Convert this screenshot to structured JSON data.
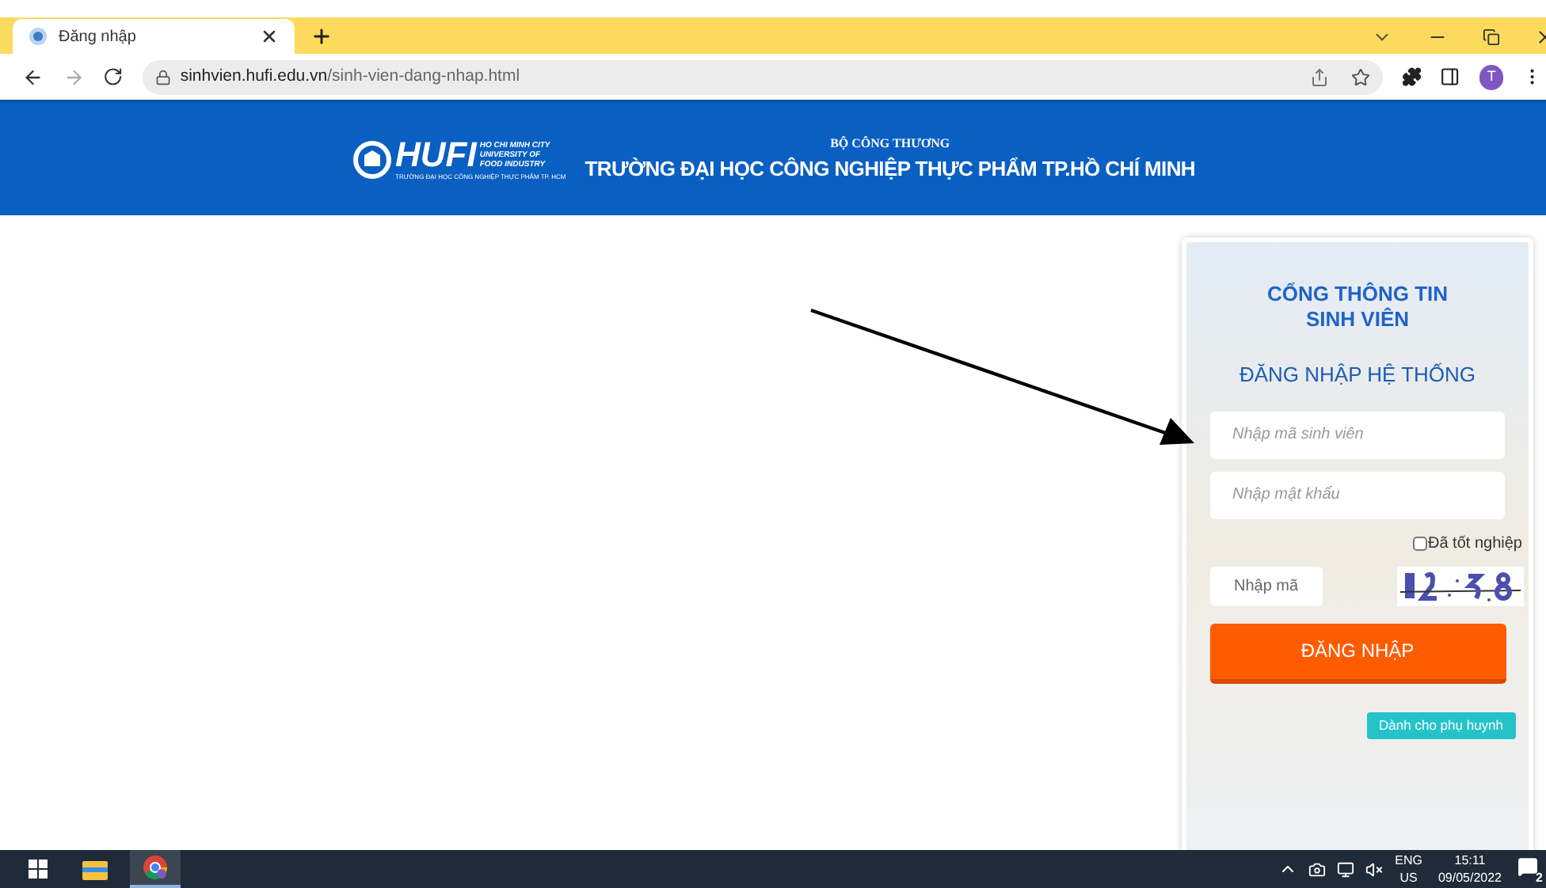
{
  "browser": {
    "tabs": [
      {
        "title": "Đăng nhập",
        "selected": true
      }
    ],
    "url_host": "sinhvien.hufi.edu.vn",
    "url_path": "/sinh-vien-dang-nhap.html",
    "profile_initial": "T"
  },
  "header": {
    "logo": {
      "wordmark": "HUFI",
      "lines": [
        "HO CHI MINH CITY",
        "UNIVERSITY OF",
        "FOOD INDUSTRY"
      ],
      "subline": "TRƯỜNG ĐẠI HỌC CÔNG NGHIỆP THỰC PHẨM TP. HCM"
    },
    "ministry": "BỘ CÔNG THƯƠNG",
    "school": "TRƯỜNG ĐẠI HỌC CÔNG NGHIỆP THỰC PHẨM TP.HỒ CHÍ MINH"
  },
  "login": {
    "portal_title": "CỔNG THÔNG TIN SINH VIÊN",
    "subtitle": "ĐĂNG NHẬP HỆ THỐNG",
    "student_id": {
      "placeholder": "Nhập mã sinh viên"
    },
    "password": {
      "placeholder": "Nhập mật khẩu"
    },
    "graduated": {
      "label": "Đã tốt nghiệp",
      "checked": false
    },
    "captcha": {
      "placeholder": "Nhập mã"
    },
    "submit": "ĐĂNG NHẬP",
    "parent_link": "Dành cho phụ huynh"
  },
  "taskbar": {
    "language": "ENG",
    "region": "US",
    "time": "15:11",
    "date": "09/05/2022",
    "notifications": "2"
  }
}
